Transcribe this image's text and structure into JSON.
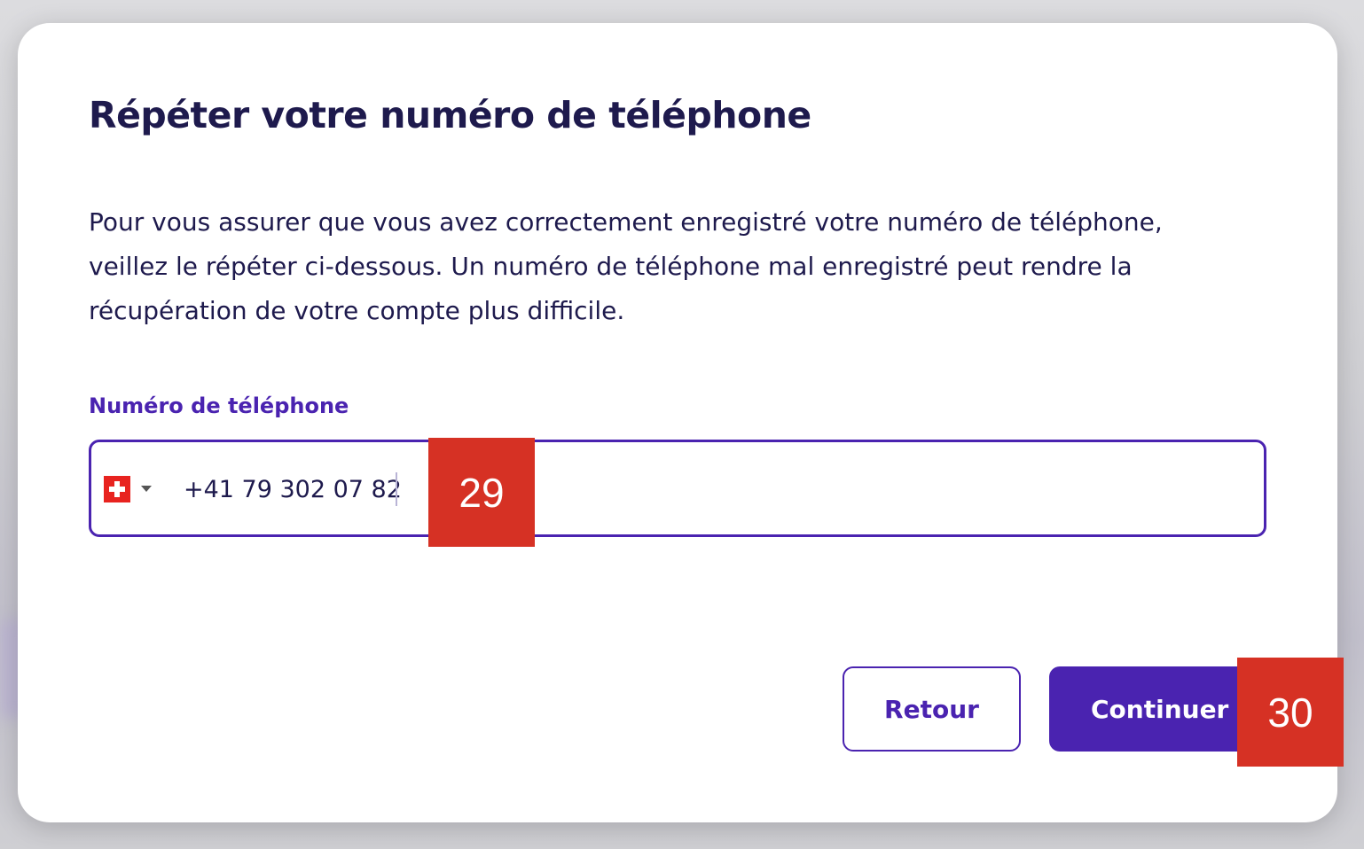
{
  "dialog": {
    "title": "Répéter votre numéro de téléphone",
    "description": "Pour vous assurer que vous avez correctement enregistré votre numéro de téléphone, veillez le répéter ci-dessous. Un numéro de téléphone mal enregistré peut rendre la récupération de votre compte plus difficile.",
    "phone_field": {
      "label": "Numéro de téléphone",
      "country_flag": "switzerland-flag-icon",
      "value": "+41 79 302 07 82"
    },
    "buttons": {
      "back_label": "Retour",
      "continue_label": "Continuer"
    }
  },
  "annotations": {
    "phone_input_marker": "29",
    "continue_button_marker": "30"
  },
  "colors": {
    "primary": "#4a23b0",
    "text_dark": "#1e1a4d",
    "marker": "#d63124"
  }
}
